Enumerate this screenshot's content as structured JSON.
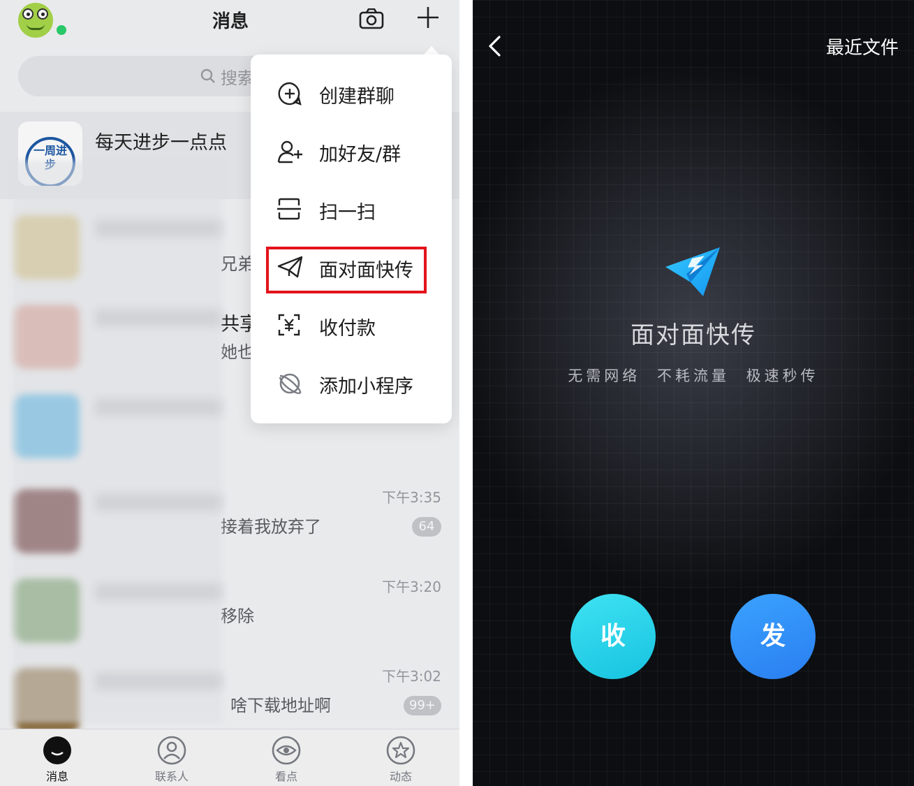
{
  "left": {
    "header": {
      "title": "消息"
    },
    "search": {
      "placeholder": "搜索"
    },
    "pinned": {
      "name": "每天进步一点点",
      "avatar_text": "一周进步"
    },
    "rows": [
      {
        "time": "",
        "msg": "兄弟",
        "badge": ""
      },
      {
        "time": "",
        "msg": "共享",
        "badge": ""
      },
      {
        "time": "",
        "msg": "",
        "badge": ""
      },
      {
        "time": "下午3:35",
        "msg": "接着我放弃了",
        "badge": "64"
      },
      {
        "time": "下午3:20",
        "msg": "移除",
        "badge": ""
      },
      {
        "time": "下午3:02",
        "msg": "啥下载地址啊",
        "badge": "99+"
      }
    ],
    "partial_texts": {
      "row2_line2": "她也"
    },
    "menu": {
      "items": [
        {
          "label": "创建群聊",
          "icon": "add-chat-icon"
        },
        {
          "label": "加好友/群",
          "icon": "add-friend-icon"
        },
        {
          "label": "扫一扫",
          "icon": "scan-icon"
        },
        {
          "label": "面对面快传",
          "icon": "paper-plane-icon"
        },
        {
          "label": "收付款",
          "icon": "payment-icon"
        },
        {
          "label": "添加小程序",
          "icon": "planet-icon"
        }
      ],
      "highlighted_index": 3,
      "highlight_color": "#e3131b"
    },
    "tabs": [
      {
        "label": "消息",
        "icon": "message-icon",
        "active": true
      },
      {
        "label": "联系人",
        "icon": "contacts-icon",
        "active": false
      },
      {
        "label": "看点",
        "icon": "eye-icon",
        "active": false
      },
      {
        "label": "动态",
        "icon": "star-icon",
        "active": false
      }
    ]
  },
  "right": {
    "recent_files": "最近文件",
    "title": "面对面快传",
    "subtitle": "无需网络  不耗流量  极速秒传",
    "receive_label": "收",
    "send_label": "发",
    "colors": {
      "receive": "#17c3e0",
      "send": "#2a7ef0",
      "plane": "#1fb5f5"
    }
  }
}
